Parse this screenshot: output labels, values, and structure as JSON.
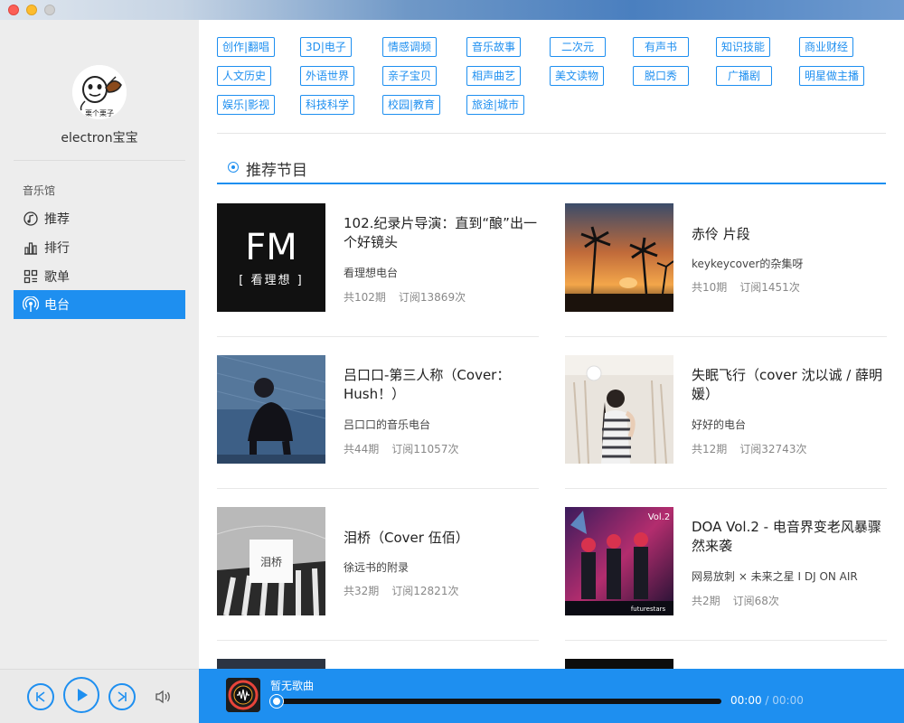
{
  "user": {
    "name": "electron宝宝",
    "avatar_caption": "栗个栗子"
  },
  "nav": {
    "section_title": "音乐馆",
    "items": [
      {
        "label": "推荐",
        "icon": "music-note-icon",
        "active": false
      },
      {
        "label": "排行",
        "icon": "bar-chart-icon",
        "active": false
      },
      {
        "label": "歌单",
        "icon": "grid-list-icon",
        "active": false
      },
      {
        "label": "电台",
        "icon": "radio-icon",
        "active": true
      }
    ]
  },
  "tags": [
    [
      "创作|翻唱",
      "3D|电子",
      "情感调频",
      "音乐故事",
      "二次元",
      "有声书",
      "知识技能",
      "商业财经"
    ],
    [
      "人文历史",
      "外语世界",
      "亲子宝贝",
      "相声曲艺",
      "美文读物",
      "脱口秀",
      "广播剧",
      "明星做主播"
    ],
    [
      "娱乐|影视",
      "科技科学",
      "校园|教育",
      "旅途|城市"
    ]
  ],
  "section": {
    "title": "推荐节目"
  },
  "programs": [
    {
      "title": "102.纪录片导演：直到“酿”出一个好镜头",
      "author": "看理想电台",
      "episodes": "共102期",
      "subs": "订阅13869次",
      "cover_fm": "FM",
      "cover_sub": "[ 看理想 ]"
    },
    {
      "title": "赤伶 片段",
      "author": "keykeycover的杂集呀",
      "episodes": "共10期",
      "subs": "订阅1451次"
    },
    {
      "title": "吕口口-第三人称（Cover：Hush！）",
      "author": "吕口口的音乐电台",
      "episodes": "共44期",
      "subs": "订阅11057次"
    },
    {
      "title": "失眠飞行（cover 沈以诚 / 薛明媛）",
      "author": "好好的电台",
      "episodes": "共12期",
      "subs": "订阅32743次"
    },
    {
      "title": "泪桥（Cover 伍佰）",
      "author": "徐远书的附录",
      "episodes": "共32期",
      "subs": "订阅12821次",
      "cover_label": "泪桥"
    },
    {
      "title": "DOA Vol.2 - 电音界变老风暴骤然来袭",
      "author": "网易放刺 × 未来之星 I DJ ON AIR",
      "episodes": "共2期",
      "subs": "订阅68次",
      "cover_vol": "Vol.2",
      "cover_brand": "futurestars"
    }
  ],
  "player": {
    "song": "暂无歌曲",
    "current": "00:00",
    "total": "00:00",
    "progress": 0
  },
  "colors": {
    "accent": "#1e8ff0",
    "sidebar_bg": "#ededed"
  }
}
